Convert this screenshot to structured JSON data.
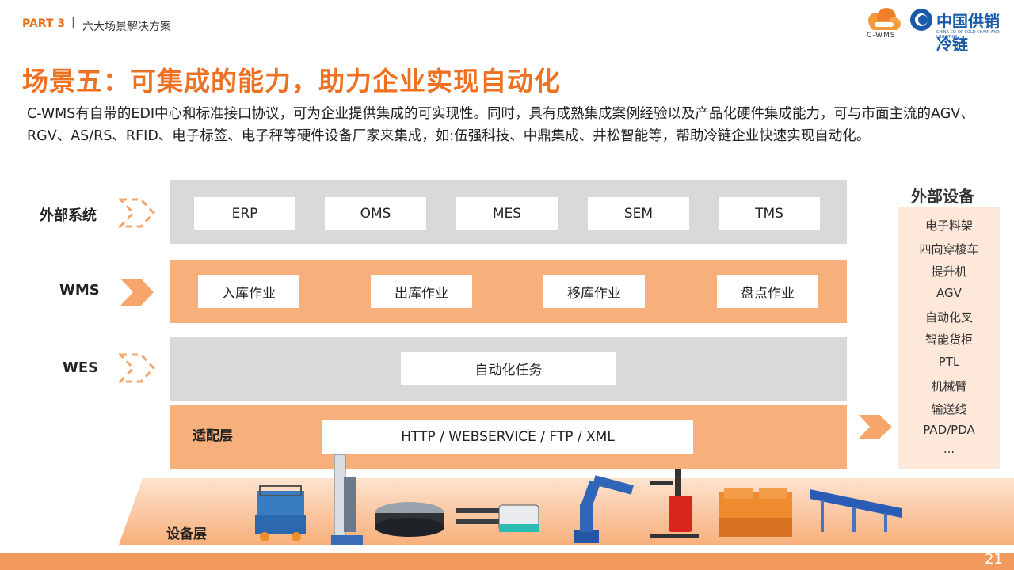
{
  "header": {
    "part": "PART 3",
    "separator": "|",
    "section": "六大场景解决方案",
    "cwms_logo_text": "C-WMS",
    "brand_logo_text": "中国供销冷链",
    "brand_logo_sub": "CHINA CO-OP COLD CHAIN AND LOGISTICS"
  },
  "title": "场景五：可集成的能力，助力企业实现自动化",
  "description": "C-WMS有自带的EDI中心和标准接口协议，可为企业提供集成的可实现性。同时，具有成熟集成案例经验以及产品化硬件集成能力，可与市面主流的AGV、RGV、AS/RS、RFID、电子标签、电子秤等硬件设备厂家来集成，如:伍强科技、中鼎集成、井松智能等，帮助冷链企业快速实现自动化。",
  "layers": {
    "external": {
      "label": "外部系统",
      "items": [
        "ERP",
        "OMS",
        "MES",
        "SEM",
        "TMS"
      ]
    },
    "wms": {
      "label": "WMS",
      "items": [
        "入库作业",
        "出库作业",
        "移库作业",
        "盘点作业"
      ]
    },
    "wes": {
      "label": "WES",
      "items": [
        "自动化任务"
      ]
    },
    "adapter": {
      "label": "适配层",
      "protocols": "HTTP / WEBSERVICE / FTP / XML"
    },
    "device": {
      "label": "设备层"
    }
  },
  "external_devices": {
    "title": "外部设备",
    "items": [
      "电子料架",
      "四向穿梭车",
      "提升机",
      "AGV",
      "自动化叉",
      "智能货柜",
      "PTL",
      "机械臂",
      "输送线",
      "PAD/PDA",
      "..."
    ]
  },
  "page_number": "21",
  "colors": {
    "accent": "#ee7021",
    "band_orange": "#f7b07c",
    "band_gray": "#d9d9d9",
    "side_panel": "#fde8da"
  }
}
